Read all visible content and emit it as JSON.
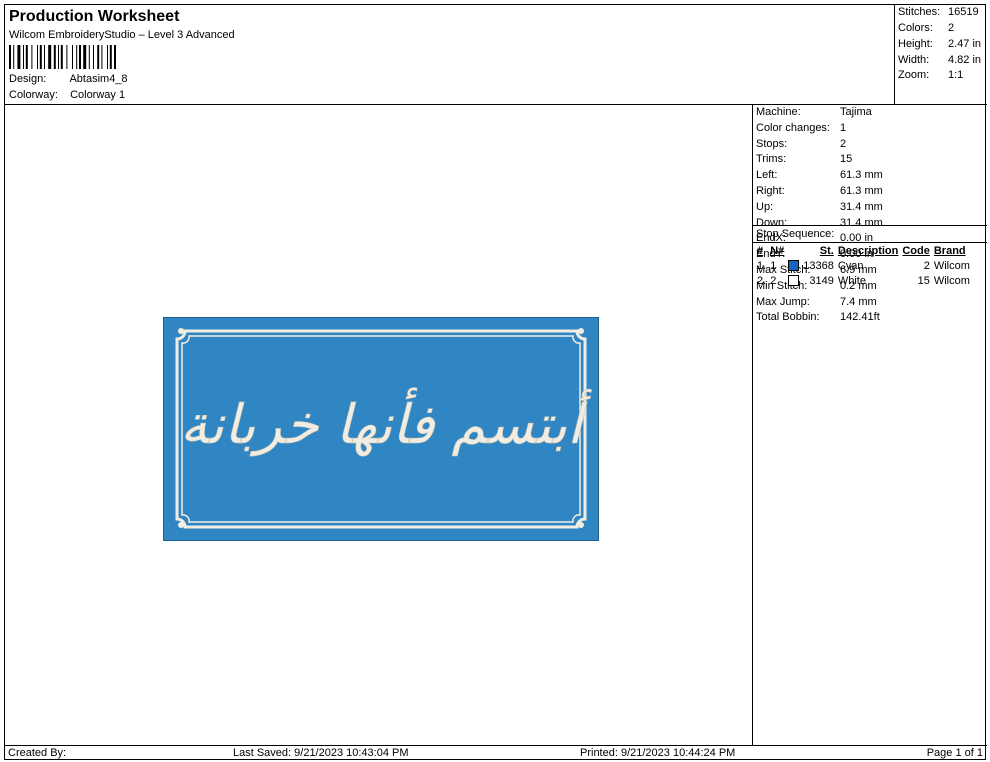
{
  "header": {
    "title": "Production Worksheet",
    "subtitle": "Wilcom EmbroideryStudio – Level 3 Advanced",
    "design_label": "Design:",
    "design_value": "Abtasim4_8",
    "colorway_label": "Colorway:",
    "colorway_value": "Colorway 1"
  },
  "stats": {
    "stitches_label": "Stitches:",
    "stitches": "16519",
    "colors_label": "Colors:",
    "colors": "2",
    "height_label": "Height:",
    "height": "2.47 in",
    "width_label": "Width:",
    "width": "4.82 in",
    "zoom_label": "Zoom:",
    "zoom": "1:1"
  },
  "design": {
    "arabic_text": "أبتسم فأنها خربانة",
    "fill_color": "#2f86c3",
    "border_color": "#f1ede2"
  },
  "machine_info": [
    {
      "label": "Machine:",
      "value": "Tajima"
    },
    {
      "label": "Color changes:",
      "value": "1"
    },
    {
      "label": "Stops:",
      "value": "2"
    },
    {
      "label": "Trims:",
      "value": "15"
    },
    {
      "label": "Left:",
      "value": "61.3 mm"
    },
    {
      "label": "Right:",
      "value": "61.3 mm"
    },
    {
      "label": "Up:",
      "value": "31.4 mm"
    },
    {
      "label": "Down:",
      "value": "31.4 mm"
    },
    {
      "label": "EndX:",
      "value": "0.00 in"
    },
    {
      "label": "EndY:",
      "value": "0.00 in"
    },
    {
      "label": "Max Stitch:",
      "value": "6.9 mm"
    },
    {
      "label": "Min Stitch:",
      "value": "0.2 mm"
    },
    {
      "label": "Max Jump:",
      "value": "7.4 mm"
    },
    {
      "label": "Total Bobbin:",
      "value": "142.41ft"
    }
  ],
  "stop_sequence": {
    "label": "Stop Sequence:",
    "headers": {
      "num": "#",
      "n": "N#",
      "st": "St.",
      "desc": "Description",
      "code": "Code",
      "brand": "Brand"
    },
    "rows": [
      {
        "num": "1.",
        "n": "1",
        "color": "#1565c0",
        "st": "13368",
        "desc": "Cyan",
        "code": "2",
        "brand": "Wilcom"
      },
      {
        "num": "2.",
        "n": "2",
        "color": "#ffffff",
        "st": "3149",
        "desc": "White",
        "code": "15",
        "brand": "Wilcom"
      }
    ]
  },
  "footer": {
    "created_by": "Created By:",
    "last_saved": "Last Saved: 9/21/2023 10:43:04 PM",
    "printed": "Printed: 9/21/2023 10:44:24 PM",
    "page": "Page 1 of 1"
  }
}
